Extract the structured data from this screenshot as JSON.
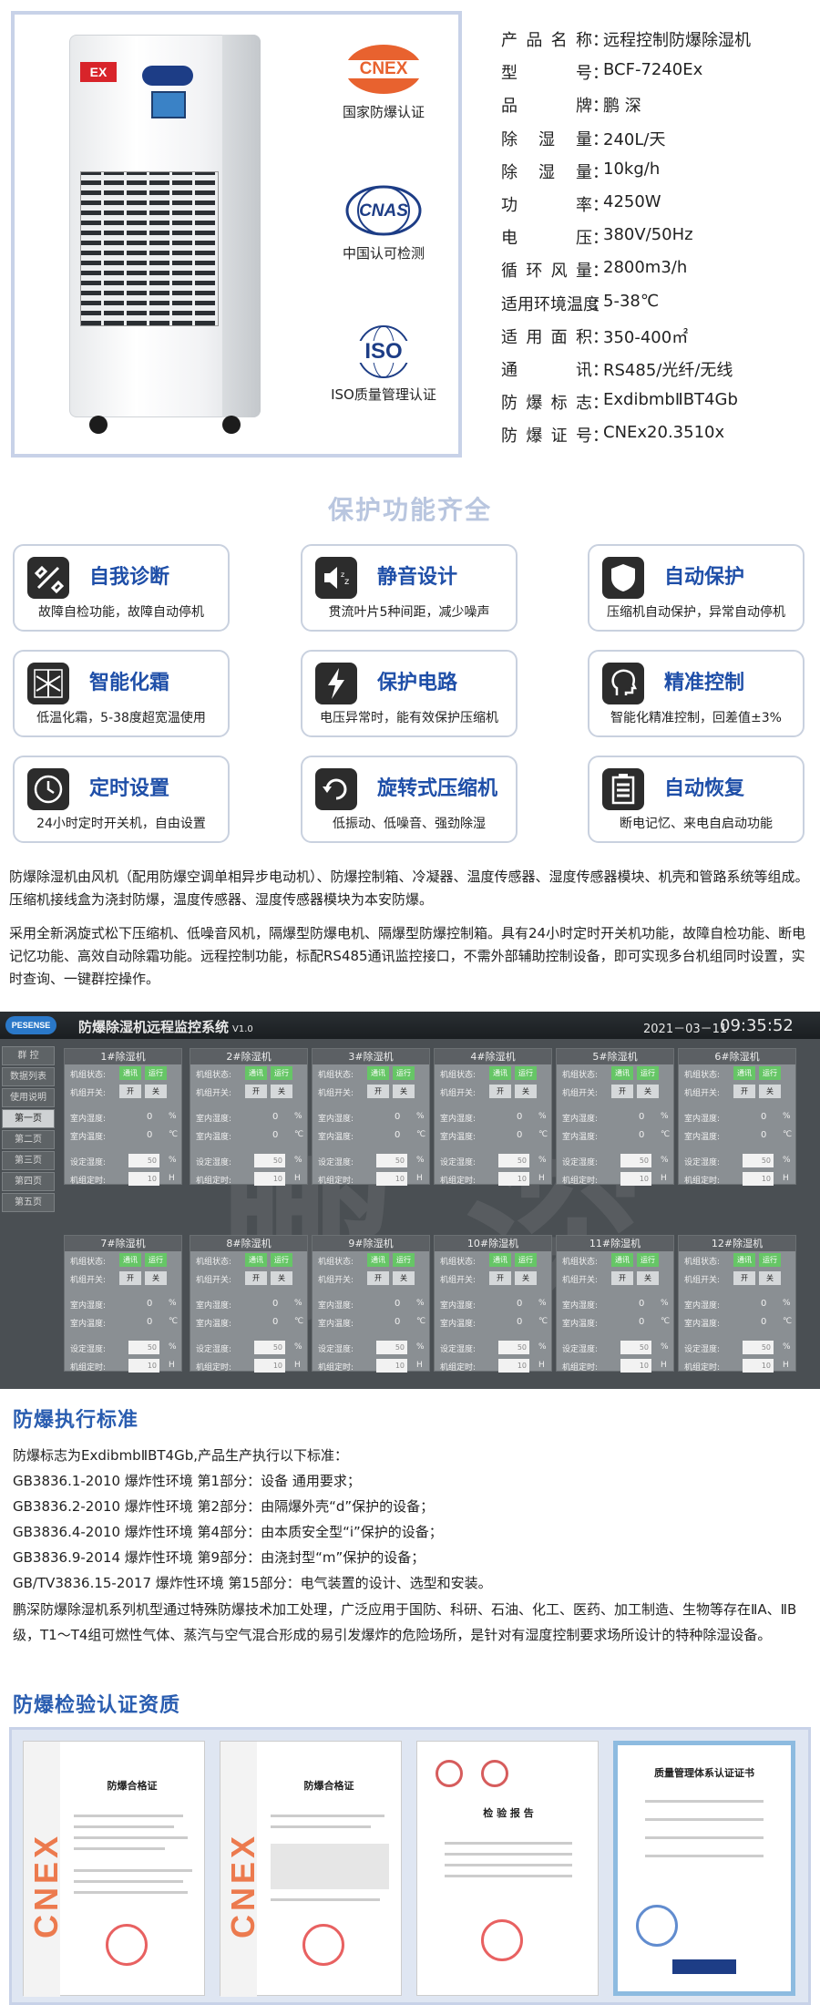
{
  "hero": {
    "ex_mark": "EX",
    "certs": [
      {
        "logo_text": "CNEX",
        "caption": "国家防爆认证",
        "color": "#e8622f"
      },
      {
        "logo_text": "CNAS",
        "caption": "中国认可检测",
        "color": "#1d3d86"
      },
      {
        "logo_text": "ISO",
        "caption": "ISO质量管理认证",
        "color": "#1d3d86"
      }
    ],
    "specs": [
      {
        "label": "产品名称",
        "value": "远程控制防爆除湿机"
      },
      {
        "label": "型号",
        "value": "BCF-7240Ex"
      },
      {
        "label": "品牌",
        "value": "鹏 深"
      },
      {
        "label": "除湿量",
        "value": "240L/天"
      },
      {
        "label": "除湿量",
        "value": "10kg/h"
      },
      {
        "label": "功率",
        "value": "4250W"
      },
      {
        "label": "电压",
        "value": "380V/50Hz"
      },
      {
        "label": "循环风量",
        "value": "2800m3/h"
      },
      {
        "label": "适用环境温度",
        "value": "5-38℃"
      },
      {
        "label": "适用面积",
        "value": "350-400㎡"
      },
      {
        "label": "通讯",
        "value": "RS485/光纤/无线"
      },
      {
        "label": "防爆标志",
        "value": "ExdibmbⅡBT4Gb"
      },
      {
        "label": "防爆证号",
        "value": "CNEx20.3510x"
      }
    ]
  },
  "features": {
    "title": "保护功能齐全",
    "items": [
      {
        "title": "自我诊断",
        "desc": "故障自检功能，故障自动停机",
        "icon": "tools-icon"
      },
      {
        "title": "静音设计",
        "desc": "贯流叶片5种间距，减少噪声",
        "icon": "speaker-icon"
      },
      {
        "title": "自动保护",
        "desc": "压缩机自动保护，异常自动停机",
        "icon": "shield-icon"
      },
      {
        "title": "智能化霜",
        "desc": "低温化霜，5-38度超宽温使用",
        "icon": "snowflake-icon"
      },
      {
        "title": "保护电路",
        "desc": "电压异常时，能有效保护压缩机",
        "icon": "lightning-icon"
      },
      {
        "title": "精准控制",
        "desc": "智能化精准控制，回差值±3%",
        "icon": "head-icon"
      },
      {
        "title": "定时设置",
        "desc": "24小时定时开关机，自由设置",
        "icon": "clock-icon"
      },
      {
        "title": "旋转式压缩机",
        "desc": "低振动、低噪音、强劲除湿",
        "icon": "rotate-icon"
      },
      {
        "title": "自动恢复",
        "desc": "断电记忆、来电自启动功能",
        "icon": "battery-icon"
      }
    ]
  },
  "description": {
    "p1": "防爆除湿机由风机（配用防爆空调单相异步电动机）、防爆控制箱、冷凝器、温度传感器、湿度传感器模块、机壳和管路系统等组成。压缩机接线盒为浇封防爆，温度传感器、湿度传感器模块为本安防爆。",
    "p2": "采用全新涡旋式松下压缩机、低噪音风机，隔爆型防爆电机、隔爆型防爆控制箱。具有24小时定时开关机功能，故障自检功能、断电记忆功能、高效自动除霜功能。远程控制功能，标配RS485通讯监控接口，不需外部辅助控制设备，即可实现多台机组同时设置，实时查询、一键群控操作。"
  },
  "monitor": {
    "logo": "PESENSE",
    "title": "防爆除湿机远程监控系统",
    "version": "V1.0",
    "date": "2021－03－11",
    "time": "09:35:52",
    "side_menu": [
      "群 控",
      "数据列表",
      "使用说明",
      "第一页",
      "第二页",
      "第三页",
      "第四页",
      "第五页"
    ],
    "labels": {
      "status": "机组状态:",
      "switch": "机组开关:",
      "indoor_hum": "室内湿度:",
      "indoor_temp": "室内温度:",
      "set_hum": "设定湿度:",
      "timer": "机组定时:",
      "comm": "通讯",
      "run": "运行",
      "on": "开",
      "off": "关",
      "unit_pct": "%",
      "unit_c": "℃",
      "unit_h": "H"
    },
    "units": [
      {
        "name": "1#除湿机",
        "hum": "0",
        "temp": "0",
        "set": "50",
        "timer": "10"
      },
      {
        "name": "2#除湿机",
        "hum": "0",
        "temp": "0",
        "set": "50",
        "timer": "10"
      },
      {
        "name": "3#除湿机",
        "hum": "0",
        "temp": "0",
        "set": "50",
        "timer": "10"
      },
      {
        "name": "4#除湿机",
        "hum": "0",
        "temp": "0",
        "set": "50",
        "timer": "10"
      },
      {
        "name": "5#除湿机",
        "hum": "0",
        "temp": "0",
        "set": "50",
        "timer": "10"
      },
      {
        "name": "6#除湿机",
        "hum": "0",
        "temp": "0",
        "set": "50",
        "timer": "10"
      },
      {
        "name": "7#除湿机",
        "hum": "0",
        "temp": "0",
        "set": "50",
        "timer": "10"
      },
      {
        "name": "8#除湿机",
        "hum": "0",
        "temp": "0",
        "set": "50",
        "timer": "10"
      },
      {
        "name": "9#除湿机",
        "hum": "0",
        "temp": "0",
        "set": "50",
        "timer": "10"
      },
      {
        "name": "10#除湿机",
        "hum": "0",
        "temp": "0",
        "set": "50",
        "timer": "10"
      },
      {
        "name": "11#除湿机",
        "hum": "0",
        "temp": "0",
        "set": "50",
        "timer": "10"
      },
      {
        "name": "12#除湿机",
        "hum": "0",
        "temp": "0",
        "set": "50",
        "timer": "10"
      }
    ]
  },
  "standards": {
    "title": "防爆执行标准",
    "lines": [
      "防爆标志为ExdibmbⅡBT4Gb,产品生产执行以下标准：",
      "GB3836.1-2010 爆炸性环境 第1部分：设备 通用要求；",
      "GB3836.2-2010 爆炸性环境 第2部分：由隔爆外壳“d”保护的设备；",
      "GB3836.4-2010 爆炸性环境 第4部分：由本质安全型“i”保护的设备；",
      "GB3836.9-2014 爆炸性环境 第9部分：由浇封型“m”保护的设备；",
      "GB/TV3836.15-2017 爆炸性环境 第15部分：电气装置的设计、选型和安装。"
    ],
    "summary": "鹏深防爆除湿机系列机型通过特殊防爆技术加工处理，广泛应用于国防、科研、石油、化工、医药、加工制造、生物等存在ⅡA、ⅡB级，T1～T4组可燃性气体、蒸汽与空气混合形成的易引发爆炸的危险场所，是针对有湿度控制要求场所设计的特种除湿设备。"
  },
  "certificates": {
    "title": "防爆检验认证资质",
    "items": [
      {
        "strip": "CNEX",
        "doc_title": "防爆合格证"
      },
      {
        "strip": "CNEX",
        "doc_title": "防爆合格证"
      },
      {
        "doc_title": "检 验 报 告"
      },
      {
        "doc_title": "质量管理体系认证证书"
      }
    ]
  }
}
